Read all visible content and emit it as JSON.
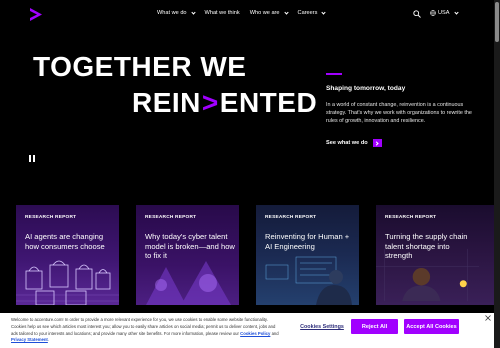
{
  "colors": {
    "brand": "#a100ff",
    "background": "#000000",
    "banner_bg": "#ffffff",
    "link": "#1d4ed8"
  },
  "header": {
    "logo_icon": "accenture-gt-logo",
    "nav": [
      {
        "label": "What we do",
        "has_dropdown": true
      },
      {
        "label": "What we think",
        "has_dropdown": false
      },
      {
        "label": "Who we are",
        "has_dropdown": true
      },
      {
        "label": "Careers",
        "has_dropdown": true
      }
    ],
    "search_icon": "search-icon",
    "locale": "USA"
  },
  "hero": {
    "line1": "TOGETHER WE",
    "line2_before": "REIN",
    "line2_accent": ">",
    "line2_after": "ENTED",
    "subtitle": "Shaping tomorrow, today",
    "description": "In a world of constant change, reinvention is a continuous strategy. That's why we work with organizations to rewrite the rules of growth, innovation and resilience.",
    "link_label": "See what we do"
  },
  "cards": [
    {
      "tag": "RESEARCH REPORT",
      "title": "AI agents are changing how consumers choose"
    },
    {
      "tag": "RESEARCH REPORT",
      "title": "Why today's cyber talent model is broken—and how to fix it"
    },
    {
      "tag": "RESEARCH REPORT",
      "title": "Reinventing for Human + AI Engineering"
    },
    {
      "tag": "RESEARCH REPORT",
      "title": "Turning the supply chain talent shortage into strength"
    }
  ],
  "cookie": {
    "text_before": "Welcome to accenture.com! In order to provide a more relevant experience for you, we use cookies to enable some website functionality. Cookies help us see which articles most interest you; allow you to easily share articles on social media; permit us to deliver content, jobs and ads tailored to your interests and locations; and provide many other site benefits. For more information, please review our ",
    "policy_link": "Cookies Policy",
    "text_and": " and ",
    "privacy_link": "Privacy Statement",
    "text_after": ".",
    "settings_label": "Cookies Settings",
    "reject_label": "Reject All",
    "accept_label": "Accept All Cookies"
  }
}
